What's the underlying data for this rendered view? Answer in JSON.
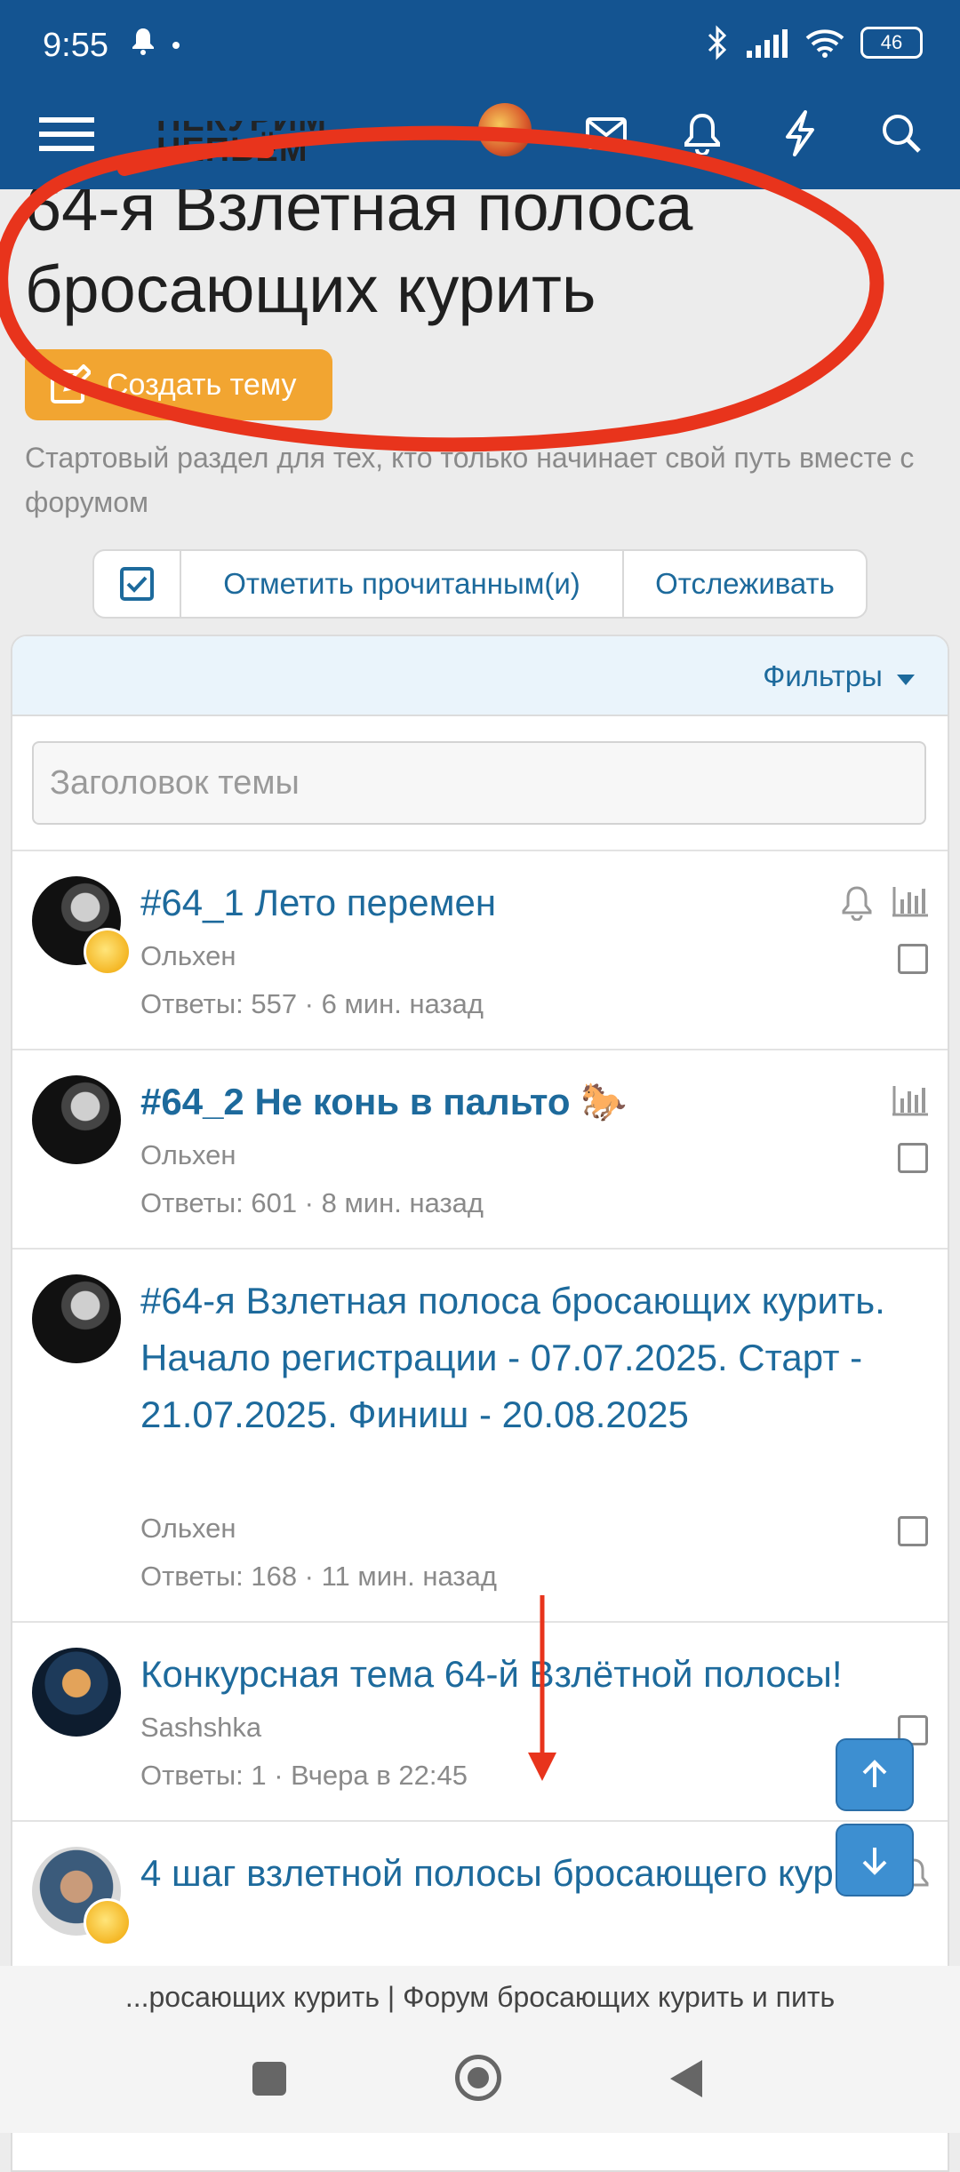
{
  "status": {
    "time": "9:55",
    "battery": "46"
  },
  "header": {
    "logo_top": "НЕКУРИМ",
    "logo_bottom": "НЕПЬЁМ"
  },
  "forum": {
    "title": "64-я Взлетная полоса бросающих курить",
    "create_label": "Создать тему",
    "description": "Стартовый раздел для тех, кто только начинает свой путь вместе с форумом",
    "mark_read": "Отметить прочитанным(и)",
    "watch": "Отслеживать",
    "filters": "Фильтры",
    "search_placeholder": "Заголовок темы"
  },
  "threads": [
    {
      "title": "#64_1 Лето перемен",
      "author": "Ольхен",
      "meta": "Ответы: 557 · 6 мин. назад"
    },
    {
      "title": "#64_2 Не конь в пальто 🐎",
      "author": "Ольхен",
      "meta": "Ответы: 601 · 8 мин. назад"
    },
    {
      "title": "#64-я Взлетная полоса бросающих курить. Начало регистрации - 07.07.2025. Старт - 21.07.2025. Финиш - 20.08.2025",
      "author": "Ольхен",
      "meta": "Ответы: 168 · 11 мин. назад"
    },
    {
      "title": "Конкурсная тема 64-й Взлётной полосы!",
      "author": "Sashshka",
      "meta": "Ответы: 1 · Вчера в 22:45"
    },
    {
      "title": "4 шаг взлетной полосы бросающего курить",
      "author": "",
      "meta": ""
    }
  ],
  "bottom_url": "...росающих курить | Форум бросающих курить и пить",
  "colors": {
    "header": "#145491",
    "link": "#1d6a9c",
    "create_button": "#f2a531",
    "annotation": "#e8341c"
  }
}
